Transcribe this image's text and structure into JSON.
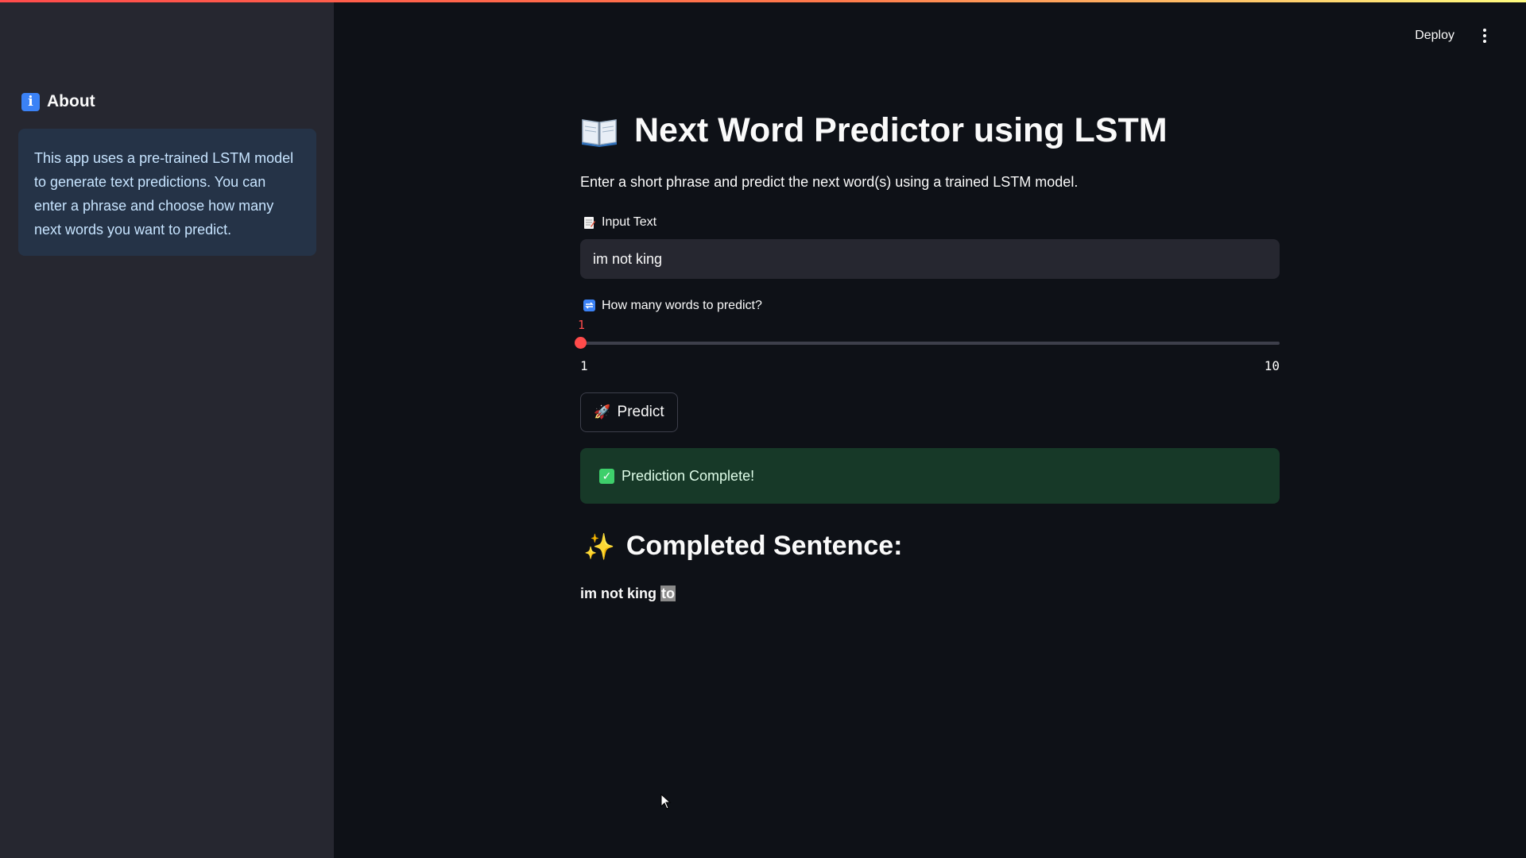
{
  "sidebar": {
    "about_title": "About",
    "about_text": "This app uses a pre-trained LSTM model to generate text predictions. You can enter a phrase and choose how many next words you want to predict."
  },
  "header": {
    "deploy_label": "Deploy"
  },
  "main": {
    "title": "Next Word Predictor using LSTM",
    "subtitle": "Enter a short phrase and predict the next word(s) using a trained LSTM model.",
    "input_label": "Input Text",
    "input_value": "im not king",
    "slider_label": "How many words to predict?",
    "slider_value": "1",
    "slider_min": "1",
    "slider_max": "10",
    "slider_fraction": 0,
    "predict_label": "Predict",
    "success_message": "Prediction Complete!",
    "completed_header": "Completed Sentence:",
    "completed_base": "im not king",
    "completed_predicted": "to"
  },
  "colors": {
    "accent": "#ff4b4b",
    "sidebar_bg": "#262730",
    "main_bg": "#0e1117",
    "info_bg": "#253347",
    "success_bg": "#173928"
  },
  "icons": {
    "about": "info-icon",
    "title": "open-book-icon",
    "input": "memo-icon",
    "slider": "repeat-icon",
    "predict": "rocket-icon",
    "success": "check-mark-icon",
    "completed": "sparkles-icon",
    "menu": "vertical-dots-icon"
  }
}
